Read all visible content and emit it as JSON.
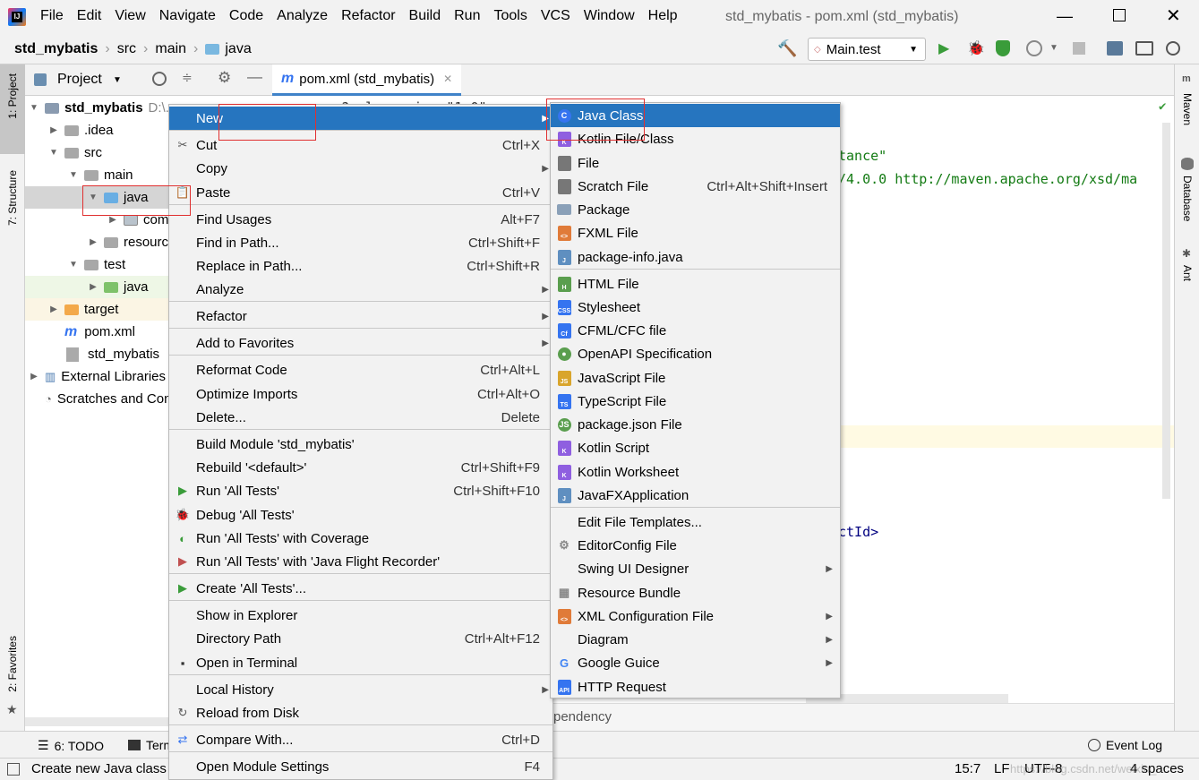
{
  "mb": {
    "logo": "intellij-logo",
    "items": [
      "File",
      "Edit",
      "View",
      "Navigate",
      "Code",
      "Analyze",
      "Refactor",
      "Build",
      "Run",
      "Tools",
      "VCS",
      "Window",
      "Help"
    ],
    "title": "std_mybatis - pom.xml (std_mybatis)"
  },
  "nav": {
    "bc": [
      "std_mybatis",
      "src",
      "main",
      "java"
    ],
    "rc": "Main.test"
  },
  "ls": {
    "proj": "1: Project",
    "str": "7: Structure",
    "fav": "2: Favorites"
  },
  "rs": {
    "mvn": "Maven",
    "db": "Database",
    "ant": "Ant"
  },
  "ph": {
    "t": "Project"
  },
  "tree": {
    "r": [
      "std_mybatis",
      "D:\\...",
      "src",
      ".idea",
      "src",
      "main",
      "java",
      "com",
      "resources",
      "test",
      "java",
      "target",
      "pom.xml",
      "std_mybatis",
      "External Libraries",
      "Scratches and Consoles"
    ]
  },
  "tab": {
    "label": "pom.xml (std_mybatis)"
  },
  "ed": {
    "l1": "<?xml version=\"1.0\"",
    "l2": "tance\"",
    "l3": "/4.0.0 http://maven.apache.org/xsd/ma",
    "l4": "ctId>",
    "l5": "pendency"
  },
  "ctx": [
    [
      "New",
      "",
      1
    ],
    [
      "Cut",
      "Ctrl+X"
    ],
    [
      "Copy",
      "",
      1
    ],
    [
      "Paste",
      "Ctrl+V"
    ],
    [
      "Find Usages",
      "Alt+F7"
    ],
    [
      "Find in Path...",
      "Ctrl+Shift+F"
    ],
    [
      "Replace in Path...",
      "Ctrl+Shift+R"
    ],
    [
      "Analyze",
      "",
      1
    ],
    [
      "Refactor",
      "",
      1
    ],
    [
      "Add to Favorites",
      "",
      1
    ],
    [
      "Reformat Code",
      "Ctrl+Alt+L"
    ],
    [
      "Optimize Imports",
      "Ctrl+Alt+O"
    ],
    [
      "Delete...",
      "Delete"
    ],
    [
      "Build Module 'std_mybatis'",
      ""
    ],
    [
      "Rebuild '<default>'",
      "Ctrl+Shift+F9"
    ],
    [
      "Run 'All Tests'",
      "Ctrl+Shift+F10"
    ],
    [
      "Debug 'All Tests'",
      ""
    ],
    [
      "Run 'All Tests' with Coverage",
      ""
    ],
    [
      "Run 'All Tests' with 'Java Flight Recorder'",
      ""
    ],
    [
      "Create 'All Tests'...",
      ""
    ],
    [
      "Show in Explorer",
      ""
    ],
    [
      "Directory Path",
      "Ctrl+Alt+F12"
    ],
    [
      "Open in Terminal",
      ""
    ],
    [
      "Local History",
      "",
      1
    ],
    [
      "Reload from Disk",
      ""
    ],
    [
      "Compare With...",
      "Ctrl+D"
    ],
    [
      "Open Module Settings",
      "F4"
    ]
  ],
  "nm": [
    [
      "Java Class",
      ""
    ],
    [
      "Kotlin File/Class",
      ""
    ],
    [
      "File",
      ""
    ],
    [
      "Scratch File",
      "Ctrl+Alt+Shift+Insert"
    ],
    [
      "Package",
      ""
    ],
    [
      "FXML File",
      ""
    ],
    [
      "package-info.java",
      ""
    ],
    [
      "HTML File",
      ""
    ],
    [
      "Stylesheet",
      ""
    ],
    [
      "CFML/CFC file",
      ""
    ],
    [
      "OpenAPI Specification",
      ""
    ],
    [
      "JavaScript File",
      ""
    ],
    [
      "TypeScript File",
      ""
    ],
    [
      "package.json File",
      ""
    ],
    [
      "Kotlin Script",
      ""
    ],
    [
      "Kotlin Worksheet",
      ""
    ],
    [
      "JavaFXApplication",
      ""
    ],
    [
      "Edit File Templates...",
      ""
    ],
    [
      "EditorConfig File",
      ""
    ],
    [
      "Swing UI Designer",
      "",
      1
    ],
    [
      "Resource Bundle",
      ""
    ],
    [
      "XML Configuration File",
      "",
      1
    ],
    [
      "Diagram",
      "",
      1
    ],
    [
      "Google Guice",
      "",
      1
    ],
    [
      "HTTP Request",
      ""
    ]
  ],
  "bb": {
    "todo": "6: TODO",
    "term": "Terminal",
    "el": "Event Log"
  },
  "sb": {
    "msg": "Create new Java class",
    "pos": "15:7",
    "le": "LF",
    "enc": "UTF-8",
    "ind": "4 spaces",
    "wm": "https://blog.csdn.net/weixin_..."
  },
  "colors": {
    "sel": "#2675bf",
    "red": "#e03030"
  }
}
